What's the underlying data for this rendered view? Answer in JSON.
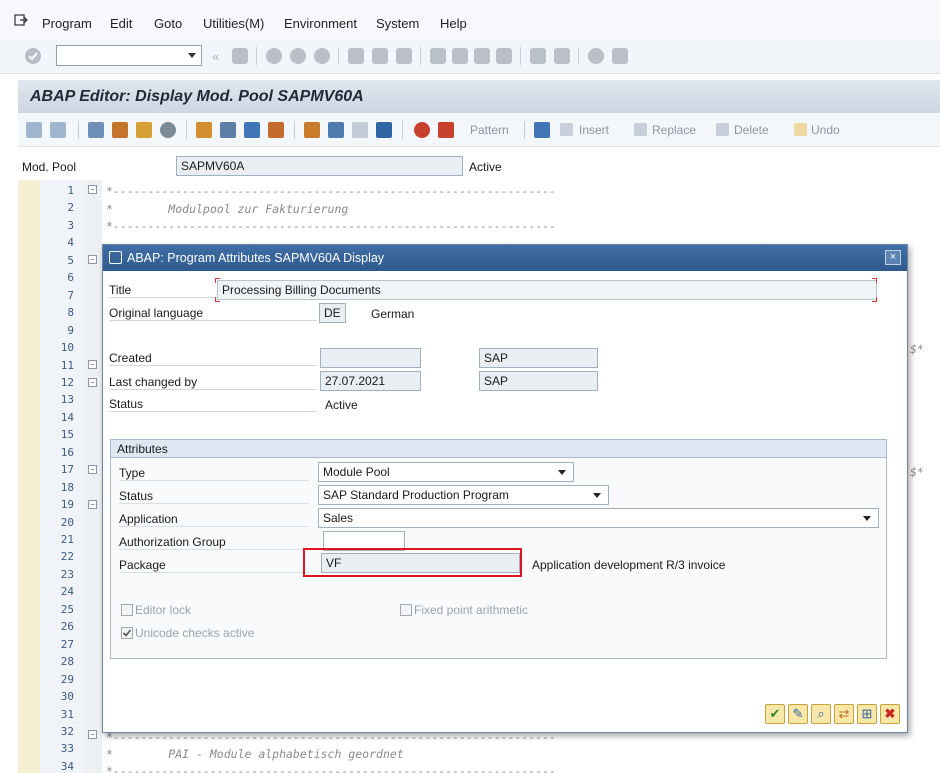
{
  "menu": {
    "items": [
      "Program",
      "Edit",
      "Goto",
      "Utilities(M)",
      "Environment",
      "System",
      "Help"
    ]
  },
  "toolbar": {
    "command_field_value": ""
  },
  "title": "ABAP Editor: Display Mod. Pool SAPMV60A",
  "app_toolbar": {
    "pattern_label": "Pattern",
    "insert_label": "Insert",
    "replace_label": "Replace",
    "delete_label": "Delete",
    "undo_label": "Undo"
  },
  "program_row": {
    "label": "Mod. Pool",
    "value": "SAPMV60A",
    "status": "Active"
  },
  "editor": {
    "line_numbers": [
      "1",
      "2",
      "3",
      "4",
      "5",
      "6",
      "7",
      "8",
      "9",
      "10",
      "11",
      "12",
      "13",
      "14",
      "15",
      "16",
      "17",
      "18",
      "19",
      "20",
      "21",
      "22",
      "23",
      "24",
      "25",
      "26",
      "27",
      "28",
      "29",
      "30",
      "31",
      "32",
      "33",
      "34"
    ],
    "line1": "*----------------------------------------------------------------",
    "line2": "*        Modulpool zur Fakturierung",
    "line3": "*----------------------------------------------------------------",
    "line10_end": "$*",
    "line17_end": "$*",
    "line32": "*----------------------------------------------------------------",
    "line33": "*        PAI - Module alphabetisch geordnet",
    "line34": "*----------------------------------------------------------------"
  },
  "dialog": {
    "title": "ABAP: Program Attributes SAPMV60A Display",
    "close_glyph": "×",
    "title_label": "Title",
    "title_value": "Processing Billing Documents",
    "orig_lang_label": "Original language",
    "orig_lang_code": "DE",
    "orig_lang_name": "German",
    "created_label": "Created",
    "created_date": "",
    "created_user": "SAP",
    "changed_label": "Last changed by",
    "changed_date": "27.07.2021",
    "changed_user": "SAP",
    "status_label": "Status",
    "status_value": "Active",
    "attributes": {
      "header": "Attributes",
      "type_label": "Type",
      "type_value": "Module Pool",
      "status_label": "Status",
      "status_value": "SAP Standard Production Program",
      "application_label": "Application",
      "application_value": "Sales",
      "auth_group_label": "Authorization Group",
      "auth_group_value": "",
      "package_label": "Package",
      "package_value": "VF",
      "package_desc": "Application development R/3 invoice",
      "editor_lock_label": "Editor lock",
      "editor_lock_checked": false,
      "fixed_point_label": "Fixed point arithmetic",
      "fixed_point_checked": false,
      "unicode_label": "Unicode checks active",
      "unicode_checked": true
    }
  },
  "colors": {
    "dialog_title_bg": "#2e5a8e",
    "highlight": "#e0141e",
    "title_bar_bg": "#cdd7e2"
  }
}
